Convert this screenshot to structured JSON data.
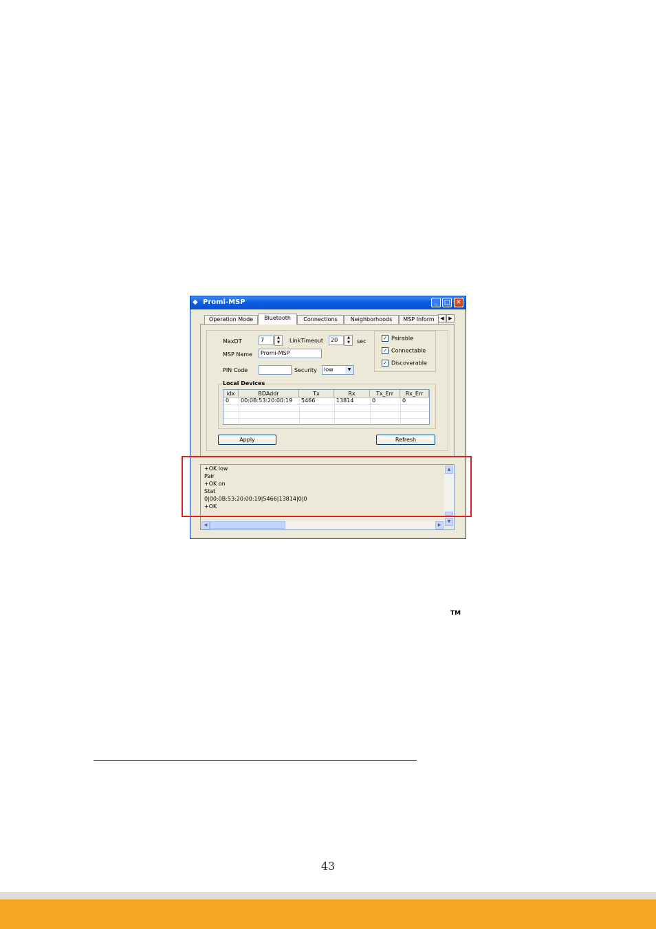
{
  "window": {
    "title": "Promi-MSP",
    "controls": {
      "minimize": "_",
      "maximize": "□",
      "close": "✕"
    }
  },
  "tabs": [
    "Operation Mode",
    "Bluetooth",
    "Connections",
    "Neighborhoods",
    "MSP Inform"
  ],
  "active_tab": "Bluetooth",
  "bluetooth": {
    "maxdt_label": "MaxDT",
    "maxdt_value": "7",
    "linktimeout_label": "LinkTimeout",
    "linktimeout_value": "20",
    "sec_label": "sec",
    "msp_name_label": "MSP Name",
    "msp_name_value": "Promi-MSP",
    "pin_code_label": "PIN Code",
    "pin_code_value": "",
    "security_label": "Security",
    "security_value": "low",
    "checkboxes": [
      {
        "label": "Pairable",
        "checked": true
      },
      {
        "label": "Connectable",
        "checked": true
      },
      {
        "label": "Discoverable",
        "checked": true
      }
    ],
    "local_devices": {
      "legend": "Local Devices",
      "columns": [
        "idx",
        "BDAddr",
        "Tx",
        "Rx",
        "Tx_Err",
        "Rx_Err"
      ],
      "rows": [
        [
          "0",
          "00:0B:53:20:00:19",
          "5466",
          "13814",
          "0",
          "0"
        ]
      ]
    },
    "apply_label": "Apply",
    "refresh_label": "Refresh"
  },
  "log_lines": [
    "+OK low",
    "Pair",
    "+OK on",
    "Stat",
    "0|00:0B:53:20:00:19|5466|13814|0|0",
    "+OK"
  ],
  "page": {
    "trademark": "TM",
    "page_number": "43"
  },
  "colors": {
    "highlight_box": "#e21e1e",
    "footer_band": "#f4a720",
    "titlebar": "#0a5ee0"
  }
}
